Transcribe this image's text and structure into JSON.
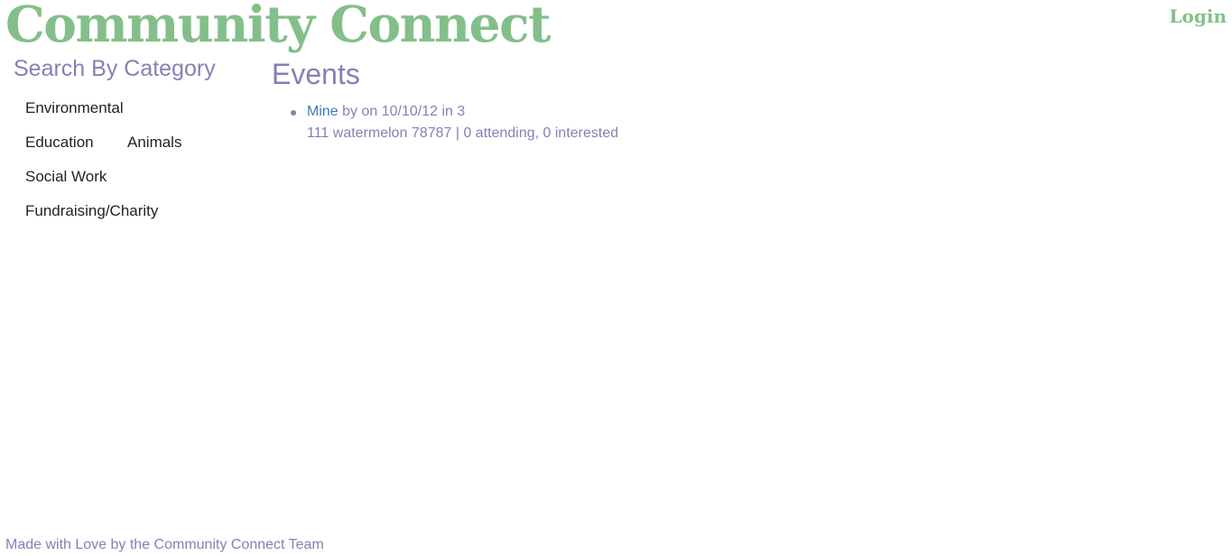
{
  "header": {
    "brand": "Community Connect",
    "login_label": "Login"
  },
  "sidebar": {
    "title": "Search By Category",
    "categories": [
      "Environmental",
      "Education",
      "Animals",
      "Social Work",
      "Fundraising/Charity"
    ]
  },
  "main": {
    "title": "Events",
    "events": [
      {
        "name": "Mine",
        "meta": " by on 10/10/12 in 3",
        "address_line": "111 watermelon 78787 | 0 attending, 0 interested"
      }
    ]
  },
  "footer": {
    "text": "Made with Love by the Community Connect Team"
  },
  "colors": {
    "brand_green": "#83bf8a",
    "accent_purple": "#8580b6",
    "link_blue": "#3b7bc4"
  }
}
